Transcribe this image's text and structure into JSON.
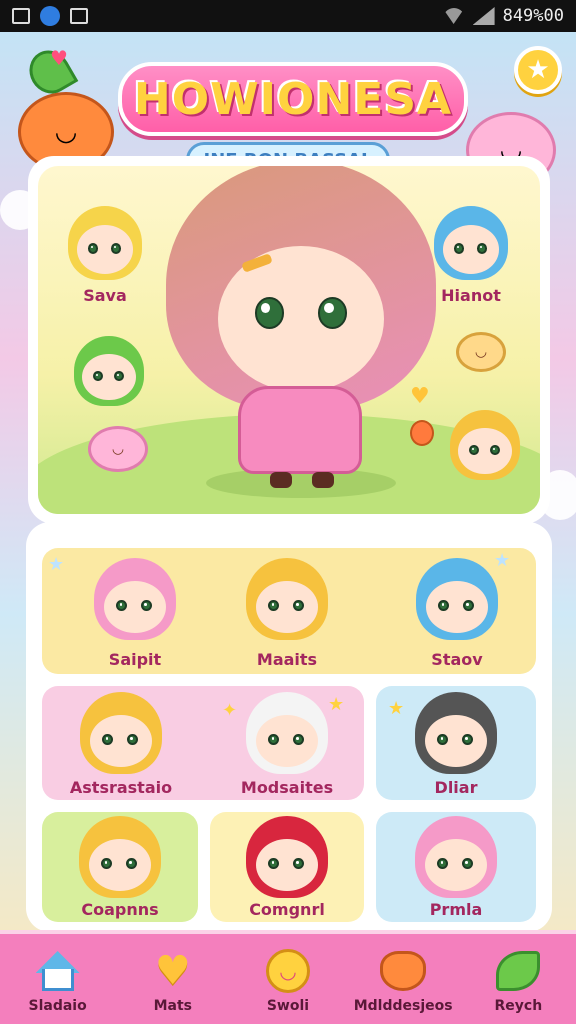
{
  "status_bar": {
    "battery_text": "849%00"
  },
  "header": {
    "title": "HOWIONESA",
    "subtitle": "INE RON BASSAL"
  },
  "hero": {
    "characters": [
      {
        "label": "Sava",
        "hair": "#f6d44a"
      },
      {
        "label": "Hianot",
        "hair": "#5ab6e8"
      }
    ]
  },
  "grid": {
    "cards": [
      {
        "label": "Saipit",
        "hair": "#f59ac8",
        "bg": "yellow"
      },
      {
        "label": "Maaits",
        "hair": "#f6c23e",
        "bg": "yellow"
      },
      {
        "label": "Staov",
        "hair": "#5ab6e8",
        "bg": "yellow"
      },
      {
        "label": "Astsrastaio",
        "hair": "#f6c23e",
        "bg": "pink"
      },
      {
        "label": "Modsaites",
        "hair": "#f4f4f4",
        "bg": "pink"
      },
      {
        "label": "Dliar",
        "hair": "#555555",
        "bg": "blue"
      },
      {
        "label": "Coapnns",
        "hair": "#f6c23e",
        "bg": "green"
      },
      {
        "label": "Comgnrl",
        "hair": "#d8263e",
        "bg": "cream"
      },
      {
        "label": "Prmla",
        "hair": "#f59ac8",
        "bg": "blue"
      }
    ]
  },
  "nav": {
    "items": [
      {
        "label": "Sladaio",
        "icon": "house-icon"
      },
      {
        "label": "Mats",
        "icon": "heart-icon"
      },
      {
        "label": "Swoli",
        "icon": "smiley-icon"
      },
      {
        "label": "Mdlddesjeos",
        "icon": "bear-icon"
      },
      {
        "label": "Reych",
        "icon": "leaf-icon"
      }
    ]
  },
  "colors": {
    "accent_pink": "#f47fbd",
    "title_yellow": "#ffd23f",
    "label_magenta": "#a3275f"
  }
}
